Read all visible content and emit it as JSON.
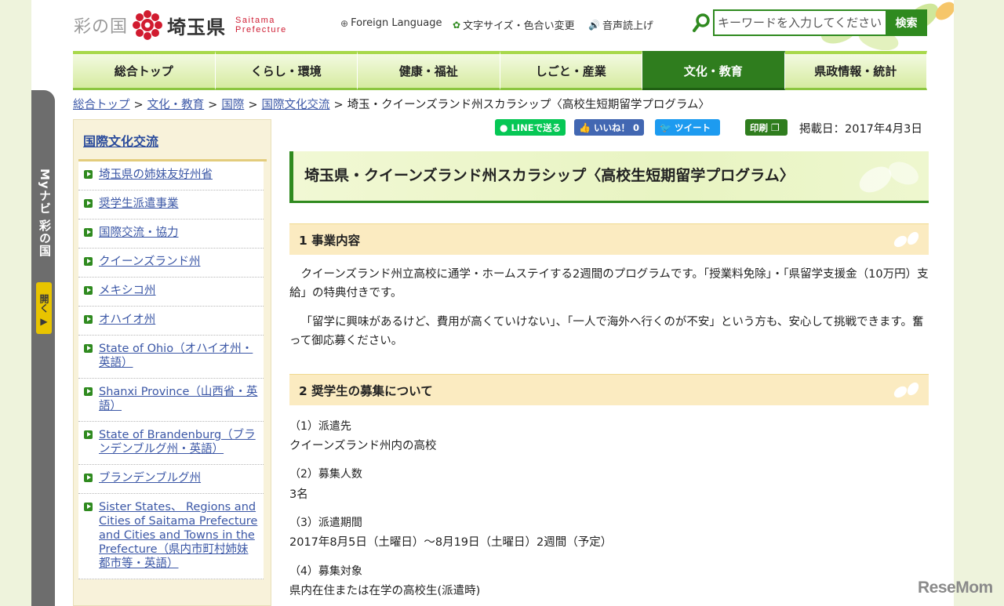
{
  "header": {
    "logo_sai": "彩の国",
    "logo_ken": "埼玉県",
    "logo_en_1": "Saitama",
    "logo_en_2": "Prefecture",
    "util": [
      {
        "icon": "globe-icon",
        "glyph": "⊕",
        "label": "Foreign Language"
      },
      {
        "icon": "gear-icon",
        "glyph": "✿",
        "label": "文字サイズ・色合い変更"
      },
      {
        "icon": "speaker-icon",
        "glyph": "🔊",
        "label": "音声読上げ"
      }
    ],
    "search_placeholder": "キーワードを入力してください",
    "search_button": "検索"
  },
  "nav": {
    "items": [
      "総合トップ",
      "くらし・環境",
      "健康・福祉",
      "しごと・産業",
      "文化・教育",
      "県政情報・統計"
    ],
    "active_index": 4
  },
  "breadcrumb": {
    "links": [
      "総合トップ",
      "文化・教育",
      "国際",
      "国際文化交流"
    ],
    "current": "埼玉・クイーンズランド州スカラシップ〈高校生短期留学プログラム〉"
  },
  "mynavi": {
    "label": "Myナビ 彩の国",
    "open": "開く ▶"
  },
  "sidebar": {
    "title": "国際文化交流",
    "items": [
      "埼玉県の姉妹友好州省",
      "奨学生派遣事業",
      "国際交流・協力",
      "クイーンズランド州",
      "メキシコ州",
      "オハイオ州",
      "State of Ohio（オハイオ州・英語）",
      "Shanxi Province（山西省・英語）",
      "State of Brandenburg（ブランデンブルグ州・英語）",
      "ブランデンブルグ州",
      "Sister States、 Regions and Cities of Saitama Prefecture and Cities and Towns in the Prefecture（県内市町村姉妹都市等・英語）"
    ]
  },
  "share": {
    "line": "LINEで送る",
    "fb": "いいね！",
    "fb_count": "0",
    "tw": "ツイート",
    "print": "印刷",
    "date": "掲載日：2017年4月3日"
  },
  "main": {
    "title": "埼玉県・クイーンズランド州スカラシップ〈高校生短期留学プログラム〉",
    "section1": {
      "heading": "1 事業内容",
      "p1": "クイーンズランド州立高校に通学・ホームステイする2週間のプログラムです。「授業料免除」・「県留学支援金（10万円）支給」の特典付きです。",
      "p2": "「留学に興味があるけど、費用が高くていけない」、「一人で海外へ行くのが不安」という方も、安心して挑戦できます。奮って御応募ください。"
    },
    "section2": {
      "heading": "2 奨学生の募集について",
      "items": [
        {
          "label": "（1）派遣先",
          "value": "クイーンズランド州内の高校"
        },
        {
          "label": "（2）募集人数",
          "value": "3名"
        },
        {
          "label": "（3）派遣期間",
          "value": "2017年8月5日（土曜日）～8月19日（土曜日）2週間（予定）"
        },
        {
          "label": "（4）募集対象",
          "value": "県内在住または在学の高校生(派遣時)"
        }
      ]
    }
  },
  "watermark": "ReseMom",
  "colors": {
    "accent_green": "#2f8a1f",
    "link_blue": "#3b57a6",
    "section_bg": "#fbebc1",
    "logo_red": "#cf1d33"
  }
}
